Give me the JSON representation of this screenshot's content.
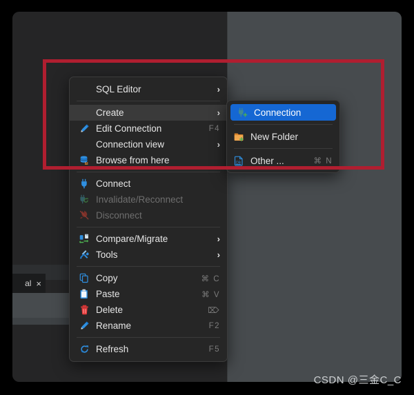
{
  "window": {
    "tab": {
      "label": "al",
      "close_icon": "×"
    }
  },
  "context_menu": {
    "groups": [
      {
        "items": [
          {
            "label": "SQL Editor",
            "icon": "none",
            "shortcut": "",
            "arrow": "›",
            "state": "normal"
          }
        ]
      },
      {
        "items": [
          {
            "label": "Create",
            "icon": "none",
            "shortcut": "",
            "arrow": "›",
            "state": "selected"
          },
          {
            "label": "Edit Connection",
            "icon": "pencil-icon",
            "shortcut": "F4",
            "arrow": "",
            "state": "normal"
          },
          {
            "label": "Connection view",
            "icon": "none",
            "shortcut": "",
            "arrow": "›",
            "state": "normal"
          },
          {
            "label": "Browse from here",
            "icon": "database-icon",
            "shortcut": "",
            "arrow": "",
            "state": "normal"
          }
        ]
      },
      {
        "items": [
          {
            "label": "Connect",
            "icon": "plug-icon",
            "shortcut": "",
            "arrow": "",
            "state": "normal"
          },
          {
            "label": "Invalidate/Reconnect",
            "icon": "plug-refresh-icon",
            "shortcut": "",
            "arrow": "",
            "state": "disabled"
          },
          {
            "label": "Disconnect",
            "icon": "plug-disconnect-icon",
            "shortcut": "",
            "arrow": "",
            "state": "disabled"
          }
        ]
      },
      {
        "items": [
          {
            "label": "Compare/Migrate",
            "icon": "compare-migrate-icon",
            "shortcut": "",
            "arrow": "›",
            "state": "normal"
          },
          {
            "label": "Tools",
            "icon": "tools-icon",
            "shortcut": "",
            "arrow": "›",
            "state": "normal"
          }
        ]
      },
      {
        "items": [
          {
            "label": "Copy",
            "icon": "copy-icon",
            "shortcut": "⌘ C",
            "arrow": "",
            "state": "normal"
          },
          {
            "label": "Paste",
            "icon": "paste-icon",
            "shortcut": "⌘ V",
            "arrow": "",
            "state": "normal"
          },
          {
            "label": "Delete",
            "icon": "trash-icon",
            "shortcut": "⌦",
            "arrow": "",
            "state": "normal"
          },
          {
            "label": "Rename",
            "icon": "rename-pencil-icon",
            "shortcut": "F2",
            "arrow": "",
            "state": "normal"
          }
        ]
      },
      {
        "items": [
          {
            "label": "Refresh",
            "icon": "refresh-icon",
            "shortcut": "F5",
            "arrow": "",
            "state": "normal"
          }
        ]
      }
    ]
  },
  "submenu": {
    "groups": [
      {
        "items": [
          {
            "label": "Connection",
            "icon": "plug-add-icon",
            "shortcut": "",
            "state": "highlight"
          }
        ]
      },
      {
        "items": [
          {
            "label": "New Folder",
            "icon": "folder-add-icon",
            "shortcut": "",
            "state": "normal"
          }
        ]
      },
      {
        "items": [
          {
            "label": "Other ...",
            "icon": "db-document-icon",
            "shortcut": "⌘ N",
            "state": "normal"
          }
        ]
      }
    ]
  },
  "watermark": {
    "text": "CSDN @三金C_C"
  },
  "colors": {
    "menu_background": "#262626",
    "menu_selected": "#3a3a3a",
    "submenu_highlight": "#1567d3",
    "annotation_red": "#b01e30",
    "panel_left": "#252526",
    "panel_right": "#474b4e",
    "text_primary": "#e6e6e6",
    "text_disabled": "#6e6e6e",
    "text_shortcut": "#7c7c7c"
  }
}
